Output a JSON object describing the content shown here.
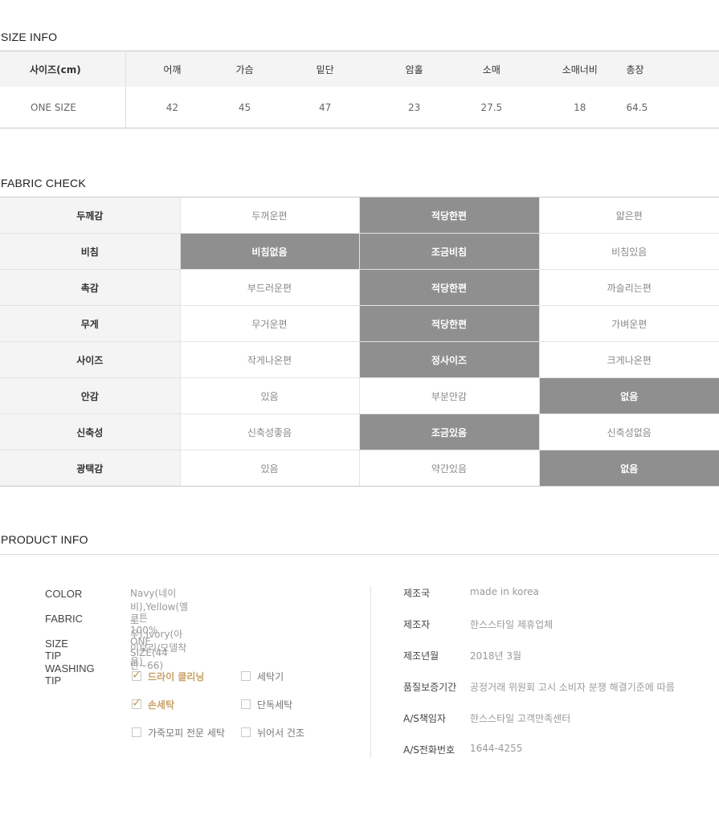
{
  "size_info": {
    "title": "SIZE INFO",
    "columns": [
      "사이즈(cm)",
      "어깨",
      "가슴",
      "밑단",
      "암홀",
      "소매",
      "소매너비",
      "총장"
    ],
    "rows": [
      [
        "ONE SIZE",
        "42",
        "45",
        "47",
        "23",
        "27.5",
        "18",
        "64.5"
      ]
    ]
  },
  "fabric_check": {
    "title": "FABRIC CHECK",
    "rows": [
      {
        "label": "두께감",
        "options": [
          "두꺼운편",
          "적당한편",
          "얇은편"
        ],
        "selected": [
          1
        ]
      },
      {
        "label": "비침",
        "options": [
          "비침없음",
          "조금비침",
          "비침있음"
        ],
        "selected": [
          0,
          1
        ]
      },
      {
        "label": "촉감",
        "options": [
          "부드러운편",
          "적당한편",
          "까슬리는편"
        ],
        "selected": [
          1
        ]
      },
      {
        "label": "무게",
        "options": [
          "무거운편",
          "적당한편",
          "가벼운편"
        ],
        "selected": [
          1
        ]
      },
      {
        "label": "사이즈",
        "options": [
          "작게나온편",
          "정사이즈",
          "크게나온편"
        ],
        "selected": [
          1
        ]
      },
      {
        "label": "안감",
        "options": [
          "있음",
          "부분안감",
          "없음"
        ],
        "selected": [
          2
        ]
      },
      {
        "label": "신축성",
        "options": [
          "신축성좋음",
          "조금있음",
          "신축성없음"
        ],
        "selected": [
          1
        ]
      },
      {
        "label": "광택감",
        "options": [
          "있음",
          "약간있음",
          "없음"
        ],
        "selected": [
          2
        ]
      }
    ],
    "selected_color": "#8f8f8f"
  },
  "product_info": {
    "title": "PRODUCT INFO",
    "left": {
      "color_label": "COLOR",
      "color_value": "Navy(네이비),Yellow(옐로우),Ivory(아이보리/모델착용)",
      "fabric_label": "FABRIC",
      "fabric_value": "코튼100%",
      "size_tip_label": "SIZE TIP",
      "size_tip_value": "ONE SIZE(44반~66)",
      "washing_tip_label": "WASHING TIP",
      "washing": [
        {
          "label": "드라이 클리닝",
          "checked": true
        },
        {
          "label": "세탁기",
          "checked": false
        },
        {
          "label": "손세탁",
          "checked": true
        },
        {
          "label": "단독세탁",
          "checked": false
        },
        {
          "label": "가죽모피 전문 세탁",
          "checked": false
        },
        {
          "label": "뉘어서 건조",
          "checked": false
        }
      ],
      "check_icon": "check-icon",
      "accent_color": "#c8a165"
    },
    "right": [
      {
        "label": "제조국",
        "value": "made in korea"
      },
      {
        "label": "제조자",
        "value": "한스스타일 제휴업체"
      },
      {
        "label": "제조년월",
        "value": "2018년 3월"
      },
      {
        "label": "품질보증기간",
        "value": "공정거래 위원회 고시 소비자 분쟁 해결기준에 따름"
      },
      {
        "label": "A/S책임자",
        "value": "한스스타일 고객만족센터"
      },
      {
        "label": "A/S전화번호",
        "value": "1644-4255"
      }
    ]
  }
}
